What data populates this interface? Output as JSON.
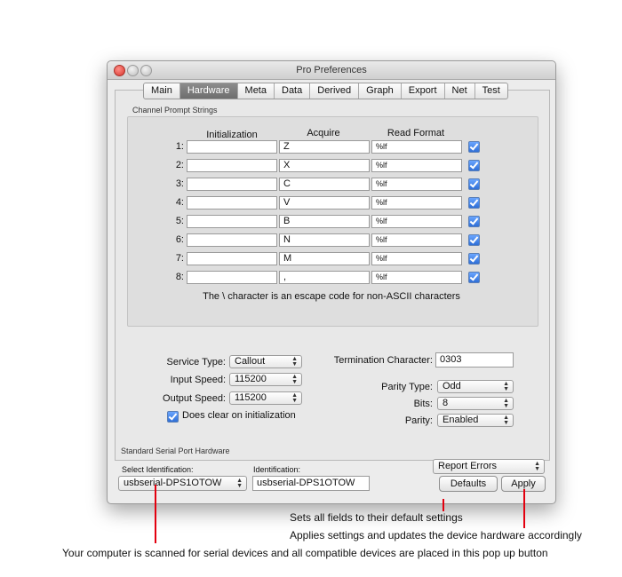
{
  "window": {
    "title": "Pro Preferences"
  },
  "tabs": [
    "Main",
    "Hardware",
    "Meta",
    "Data",
    "Derived",
    "Graph",
    "Export",
    "Net",
    "Test"
  ],
  "prompt_strings": {
    "label": "Channel Prompt Strings",
    "headers": {
      "initialization": "Initialization",
      "acquire": "Acquire",
      "read_format": "Read Format"
    },
    "rows": [
      {
        "num": "1:",
        "init": "",
        "acquire": "Z",
        "format": "%lf",
        "checked": true
      },
      {
        "num": "2:",
        "init": "",
        "acquire": "X",
        "format": "%lf",
        "checked": true
      },
      {
        "num": "3:",
        "init": "",
        "acquire": "C",
        "format": "%lf",
        "checked": true
      },
      {
        "num": "4:",
        "init": "",
        "acquire": "V",
        "format": "%lf",
        "checked": true
      },
      {
        "num": "5:",
        "init": "",
        "acquire": "B",
        "format": "%lf",
        "checked": true
      },
      {
        "num": "6:",
        "init": "",
        "acquire": "N",
        "format": "%lf",
        "checked": true
      },
      {
        "num": "7:",
        "init": "",
        "acquire": "M",
        "format": "%lf",
        "checked": true
      },
      {
        "num": "8:",
        "init": "",
        "acquire": ",",
        "format": "%lf",
        "checked": true
      }
    ],
    "note": "The \\ character is an escape code for non-ASCII characters"
  },
  "serial": {
    "service_type_label": "Service Type:",
    "service_type": "Callout",
    "input_speed_label": "Input Speed:",
    "input_speed": "115200",
    "output_speed_label": "Output Speed:",
    "output_speed": "115200",
    "clear_label": "Does clear on initialization",
    "termination_label": "Termination Character:",
    "termination": "0303",
    "parity_type_label": "Parity Type:",
    "parity_type": "Odd",
    "bits_label": "Bits:",
    "bits": "8",
    "parity_label": "Parity:",
    "parity": "Enabled"
  },
  "hardware": {
    "section_label": "Standard Serial Port Hardware",
    "select_id_label": "Select Identification:",
    "select_id": "usbserial-DPS1OTOW",
    "id_label": "Identification:",
    "id_value": "usbserial-DPS1OTOW",
    "report_errors": "Report Errors",
    "defaults": "Defaults",
    "apply": "Apply"
  },
  "callouts": {
    "defaults": "Sets all fields to their default settings",
    "apply": "Applies settings and updates the device hardware accordingly",
    "select": "Your computer is scanned for serial devices and all compatible devices are placed in this pop up button"
  },
  "colors": {
    "callout_line": "#e3000f",
    "checkbox": "#2f6fd6",
    "active_tab": "#7a7a7a"
  }
}
